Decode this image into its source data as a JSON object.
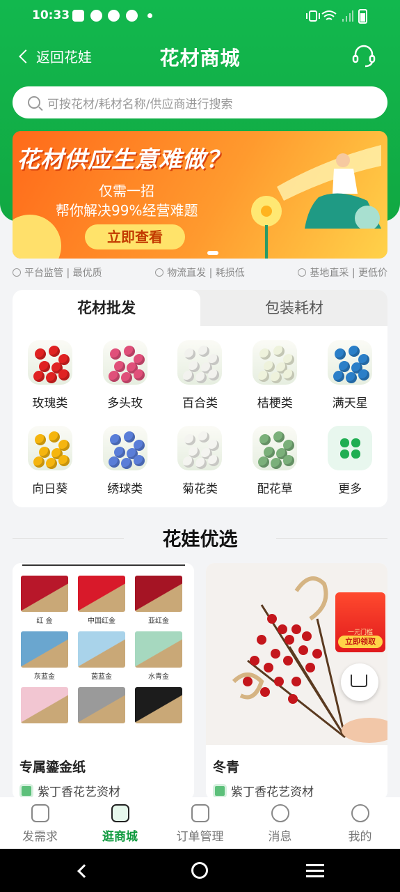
{
  "status_bar": {
    "time": "10:33"
  },
  "nav": {
    "back_label": "返回花娃",
    "title": "花材商城"
  },
  "search": {
    "placeholder": "可按花材/耗材名称/供应商进行搜索"
  },
  "banner": {
    "headline": "花材供应生意难做？",
    "line1": "仅需一招",
    "line2": "帮你解决99%经营难题",
    "button": "立即查看"
  },
  "features": [
    {
      "icon": "shield-icon",
      "text": "平台监管 | 最优质"
    },
    {
      "icon": "truck-icon",
      "text": "物流直发 | 耗损低"
    },
    {
      "icon": "warehouse-icon",
      "text": "基地直采 | 更低价"
    }
  ],
  "tabs": [
    {
      "label": "花材批发",
      "active": true
    },
    {
      "label": "包装耗材",
      "active": false
    }
  ],
  "categories": [
    {
      "label": "玫瑰类",
      "color": "#e02222"
    },
    {
      "label": "多头玫",
      "color": "#e0507a"
    },
    {
      "label": "百合类",
      "color": "#f2f2ee"
    },
    {
      "label": "桔梗类",
      "color": "#eef2dc"
    },
    {
      "label": "满天星",
      "color": "#2b7fc8"
    },
    {
      "label": "向日葵",
      "color": "#f5b50f"
    },
    {
      "label": "绣球类",
      "color": "#5a7ed8"
    },
    {
      "label": "菊花类",
      "color": "#f4f4f0"
    },
    {
      "label": "配花草",
      "color": "#7bb07a"
    },
    {
      "label": "更多",
      "color": "#1fae52"
    }
  ],
  "section_title": "花娃优选",
  "products": [
    {
      "name": "专属鎏金纸",
      "shop": "紫丁香花艺资材",
      "swatches": [
        {
          "label": "红 金",
          "color": "#b8172a"
        },
        {
          "label": "中国红金",
          "color": "#d8192a"
        },
        {
          "label": "亚红金",
          "color": "#a51424"
        },
        {
          "label": "灰蓝金",
          "color": "#6aa6cf"
        },
        {
          "label": "茵蓝金",
          "color": "#a9d3ea"
        },
        {
          "label": "水青金",
          "color": "#a6d8bf"
        },
        {
          "label": "",
          "color": "#f2c6d2"
        },
        {
          "label": "",
          "color": "#9a9a9a"
        },
        {
          "label": "",
          "color": "#1c1c1c"
        }
      ]
    },
    {
      "name": "冬青",
      "shop": "紫丁香花艺资材",
      "promo": "立即领取",
      "promo_sub": "一元门槛"
    }
  ],
  "tabbar": [
    {
      "label": "发需求",
      "icon": "pen-icon",
      "active": false
    },
    {
      "label": "逛商城",
      "icon": "store-icon",
      "active": true
    },
    {
      "label": "订单管理",
      "icon": "clipboard-icon",
      "active": false
    },
    {
      "label": "消息",
      "icon": "message-icon",
      "active": false
    },
    {
      "label": "我的",
      "icon": "user-icon",
      "active": false
    }
  ],
  "colors": {
    "brand_green": "#12b84e",
    "active_tab": "#0f9a3e",
    "banner_orange": "#ff6a1a"
  }
}
